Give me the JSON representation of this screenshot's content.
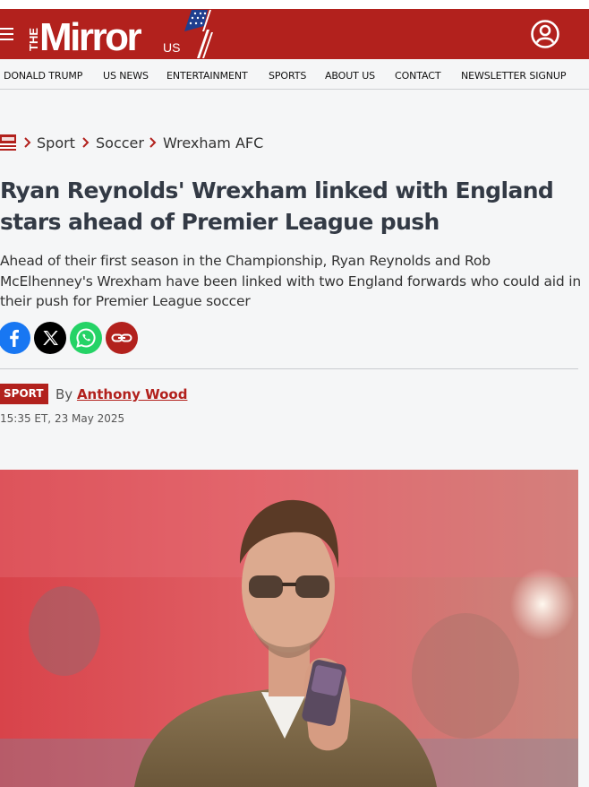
{
  "header": {
    "logo_text": "THE Mirror US",
    "menu_icon": "hamburger-menu-icon",
    "account_icon": "user-account-icon",
    "brand_color": "#b2211d"
  },
  "nav": {
    "items": [
      "DONALD TRUMP",
      "US NEWS",
      "ENTERTAINMENT",
      "SPORTS",
      "ABOUT US",
      "CONTACT",
      "NEWSLETTER SIGNUP"
    ]
  },
  "breadcrumb": {
    "items": [
      "Sport",
      "Soccer",
      "Wrexham AFC"
    ]
  },
  "article": {
    "title": "Ryan Reynolds' Wrexham linked with England stars ahead of Premier League push",
    "standfirst": "Ahead of their first season in the Championship, Ryan Reynolds and Rob McElhenney's Wrexham have been linked with two England forwards who could aid in their push for Premier League soccer",
    "category_badge": "SPORT",
    "by_prefix": "By",
    "author": "Anthony Wood",
    "timestamp": "15:35 ET, 23 May 2025"
  },
  "share": {
    "buttons": [
      {
        "icon": "facebook-icon",
        "color": "#1877f2"
      },
      {
        "icon": "x-icon",
        "color": "#000000"
      },
      {
        "icon": "whatsapp-icon",
        "color": "#25d366"
      },
      {
        "icon": "link-icon",
        "color": "#b2211d"
      }
    ]
  }
}
